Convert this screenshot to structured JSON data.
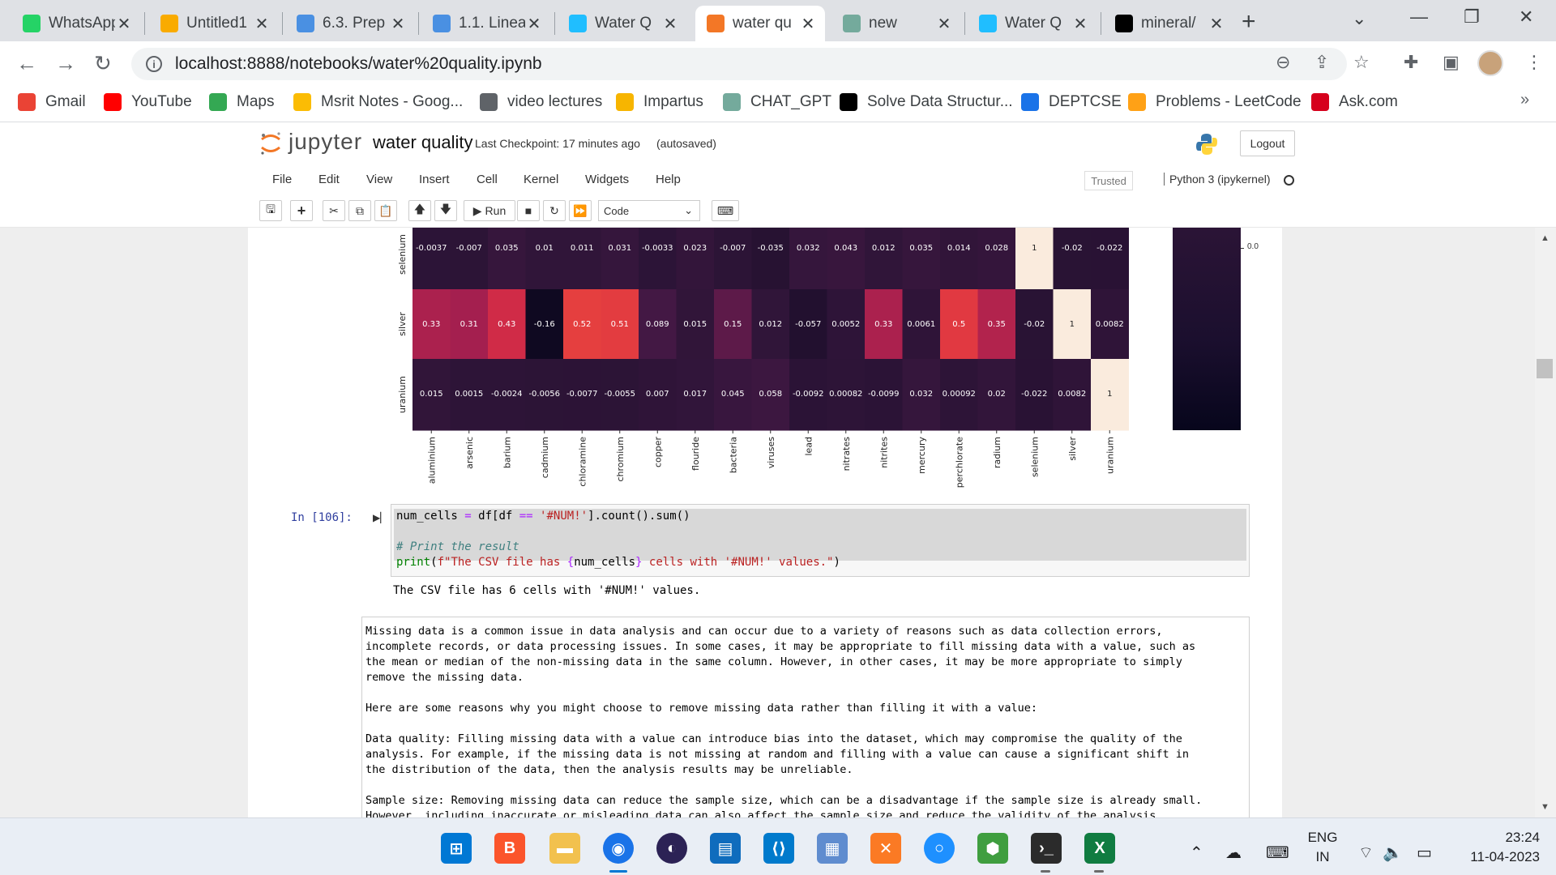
{
  "browser": {
    "tabs": [
      {
        "title": "WhatsApp",
        "icon": "whatsapp-icon",
        "color": "#25d366"
      },
      {
        "title": "Untitled1",
        "icon": "colab-icon",
        "color": "#f9ab00"
      },
      {
        "title": "6.3. Prep",
        "icon": "d2l-icon",
        "color": "#4a90e2"
      },
      {
        "title": "1.1. Linea",
        "icon": "d2l-icon",
        "color": "#4a90e2"
      },
      {
        "title": "Water Q",
        "icon": "kaggle-icon",
        "color": "#20beff"
      },
      {
        "title": "water qu",
        "icon": "jupyter-icon",
        "color": "#f37726"
      },
      {
        "title": "new",
        "icon": "chatgpt-icon",
        "color": "#74aa9c"
      },
      {
        "title": "Water Q",
        "icon": "kaggle-icon",
        "color": "#20beff"
      },
      {
        "title": "mineral/",
        "icon": "github-icon",
        "color": "#000000"
      }
    ],
    "url": "localhost:8888/notebooks/water%20quality.ipynb",
    "bookmarks": [
      {
        "label": "Gmail",
        "icon": "gmail-icon",
        "color": "#ea4335"
      },
      {
        "label": "YouTube",
        "icon": "youtube-icon",
        "color": "#ff0000"
      },
      {
        "label": "Maps",
        "icon": "maps-icon",
        "color": "#34a853"
      },
      {
        "label": "Msrit Notes - Goog...",
        "icon": "drive-icon",
        "color": "#fbbc04"
      },
      {
        "label": "video lectures",
        "icon": "globe-icon",
        "color": "#5f6368"
      },
      {
        "label": "Impartus",
        "icon": "impartus-icon",
        "color": "#f7b500"
      },
      {
        "label": "CHAT_GPT",
        "icon": "chatgpt-icon",
        "color": "#74aa9c"
      },
      {
        "label": "Solve Data Structur...",
        "icon": "hackerrank-icon",
        "color": "#000000"
      },
      {
        "label": "DEPTCSE",
        "icon": "deptcse-icon",
        "color": "#1a73e8"
      },
      {
        "label": "Problems - LeetCode",
        "icon": "leetcode-icon",
        "color": "#ffa116"
      },
      {
        "label": "Ask.com",
        "icon": "ask-icon",
        "color": "#d6001c"
      }
    ]
  },
  "jupyter": {
    "logo_text": "jupyter",
    "notebook_name": "water quality",
    "checkpoint": "Last Checkpoint: 17 minutes ago",
    "autosave": "(autosaved)",
    "logout": "Logout",
    "menu": [
      "File",
      "Edit",
      "View",
      "Insert",
      "Cell",
      "Kernel",
      "Widgets",
      "Help"
    ],
    "trusted": "Trusted",
    "kernel": "Python 3 (ipykernel)",
    "run_label": "Run",
    "cell_type": "Code"
  },
  "chart_data": {
    "type": "heatmap",
    "columns": [
      "aluminium",
      "arsenic",
      "barium",
      "cadmium",
      "chloramine",
      "chromium",
      "copper",
      "flouride",
      "bacteria",
      "viruses",
      "lead",
      "nitrates",
      "nitrites",
      "mercury",
      "perchlorate",
      "radium",
      "selenium",
      "silver",
      "uranium"
    ],
    "rows": [
      {
        "name": "selenium",
        "labels": [
          "-0.0037",
          "-0.007",
          "0.035",
          "0.01",
          "0.011",
          "0.031",
          "-0.0033",
          "0.023",
          "-0.007",
          "-0.035",
          "0.032",
          "0.043",
          "0.012",
          "0.035",
          "0.014",
          "0.028",
          "1",
          "-0.02",
          "-0.022"
        ]
      },
      {
        "name": "silver",
        "labels": [
          "0.33",
          "0.31",
          "0.43",
          "-0.16",
          "0.52",
          "0.51",
          "0.089",
          "0.015",
          "0.15",
          "0.012",
          "-0.057",
          "0.0052",
          "0.33",
          "0.0061",
          "0.5",
          "0.35",
          "-0.02",
          "1",
          "0.0082"
        ]
      },
      {
        "name": "uranium",
        "labels": [
          "0.015",
          "0.0015",
          "-0.0024",
          "-0.0056",
          "-0.0077",
          "-0.0055",
          "0.007",
          "0.017",
          "0.045",
          "0.058",
          "-0.0092",
          "0.00082",
          "-0.0099",
          "0.032",
          "0.00092",
          "0.02",
          "-0.022",
          "0.0082",
          "1"
        ]
      }
    ],
    "colorbar_tick": "0.0"
  },
  "code_cell": {
    "prompt": "In [106]:",
    "output": "The CSV file has 6 cells with '#NUM!' values."
  },
  "markdown": {
    "paragraphs": [
      "Missing data is a common issue in data analysis and can occur due to a variety of reasons such as data collection errors,\nincomplete records, or data processing issues. In some cases, it may be appropriate to fill missing data with a value, such as\nthe mean or median of the non-missing data in the same column. However, in other cases, it may be more appropriate to simply\nremove the missing data.",
      "Here are some reasons why you might choose to remove missing data rather than filling it with a value:",
      "Data quality: Filling missing data with a value can introduce bias into the dataset, which may compromise the quality of the\nanalysis. For example, if the missing data is not missing at random and filling with a value can cause a significant shift in\nthe distribution of the data, then the analysis results may be unreliable.",
      "Sample size: Removing missing data can reduce the sample size, which can be a disadvantage if the sample size is already small.\nHowever, including inaccurate or misleading data can also affect the sample size and reduce the validity of the analysis."
    ]
  },
  "taskbar": {
    "lang": "ENG",
    "region": "IN",
    "time": "23:24",
    "date": "11-04-2023"
  }
}
